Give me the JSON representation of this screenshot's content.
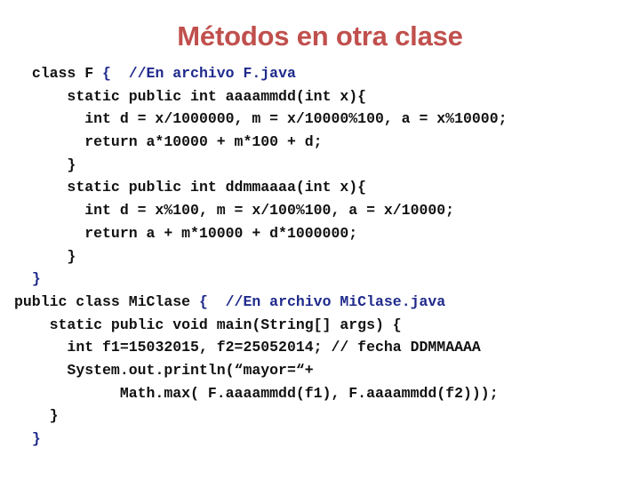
{
  "slide": {
    "title": "Métodos en otra clase",
    "title_color": "#C0504D",
    "background_color": "#FFFFFF",
    "code_color": "#111111",
    "comment_color": "#1F2A8C",
    "code_lines": [
      {
        "indent": "  ",
        "segments": [
          {
            "text": "class F ",
            "kind": "plain"
          },
          {
            "text": "{",
            "kind": "brace"
          },
          {
            "text": "  ",
            "kind": "plain"
          },
          {
            "text": "//En archivo F.java",
            "kind": "comment"
          }
        ]
      },
      {
        "indent": "      ",
        "segments": [
          {
            "text": "static public int aaaammdd(int x){",
            "kind": "plain"
          }
        ]
      },
      {
        "indent": "        ",
        "segments": [
          {
            "text": "int d = x/1000000, m = x/10000%100, a = x%10000;",
            "kind": "plain"
          }
        ]
      },
      {
        "indent": "        ",
        "segments": [
          {
            "text": "return a*10000 + m*100 + d;",
            "kind": "plain"
          }
        ]
      },
      {
        "indent": "      ",
        "segments": [
          {
            "text": "}",
            "kind": "plain"
          }
        ]
      },
      {
        "indent": "      ",
        "segments": [
          {
            "text": "static public int ddmmaaaa(int x){",
            "kind": "plain"
          }
        ]
      },
      {
        "indent": "        ",
        "segments": [
          {
            "text": "int d = x%100, m = x/100%100, a = x/10000;",
            "kind": "plain"
          }
        ]
      },
      {
        "indent": "        ",
        "segments": [
          {
            "text": "return a + m*10000 + d*1000000;",
            "kind": "plain"
          }
        ]
      },
      {
        "indent": "      ",
        "segments": [
          {
            "text": "}",
            "kind": "plain"
          }
        ]
      },
      {
        "indent": "  ",
        "segments": [
          {
            "text": "}",
            "kind": "brace"
          }
        ]
      },
      {
        "indent": "",
        "segments": [
          {
            "text": "public class MiClase ",
            "kind": "plain"
          },
          {
            "text": "{",
            "kind": "brace"
          },
          {
            "text": "  ",
            "kind": "plain"
          },
          {
            "text": "//En archivo MiClase.java",
            "kind": "comment"
          }
        ]
      },
      {
        "indent": "    ",
        "segments": [
          {
            "text": "static public void main(String[] args) {",
            "kind": "plain"
          }
        ]
      },
      {
        "indent": "      ",
        "segments": [
          {
            "text": "int f1=15032015, f2=25052014; // fecha DDMMAAAA",
            "kind": "plain"
          }
        ]
      },
      {
        "indent": "      ",
        "segments": [
          {
            "text": "System.out.println(“mayor=“+",
            "kind": "plain"
          }
        ]
      },
      {
        "indent": "            ",
        "segments": [
          {
            "text": "Math.max( F.aaaammdd(f1), F.aaaammdd(f2)));",
            "kind": "plain"
          }
        ]
      },
      {
        "indent": "    ",
        "segments": [
          {
            "text": "}",
            "kind": "plain"
          }
        ]
      },
      {
        "indent": "  ",
        "segments": [
          {
            "text": "}",
            "kind": "brace"
          }
        ]
      }
    ]
  }
}
